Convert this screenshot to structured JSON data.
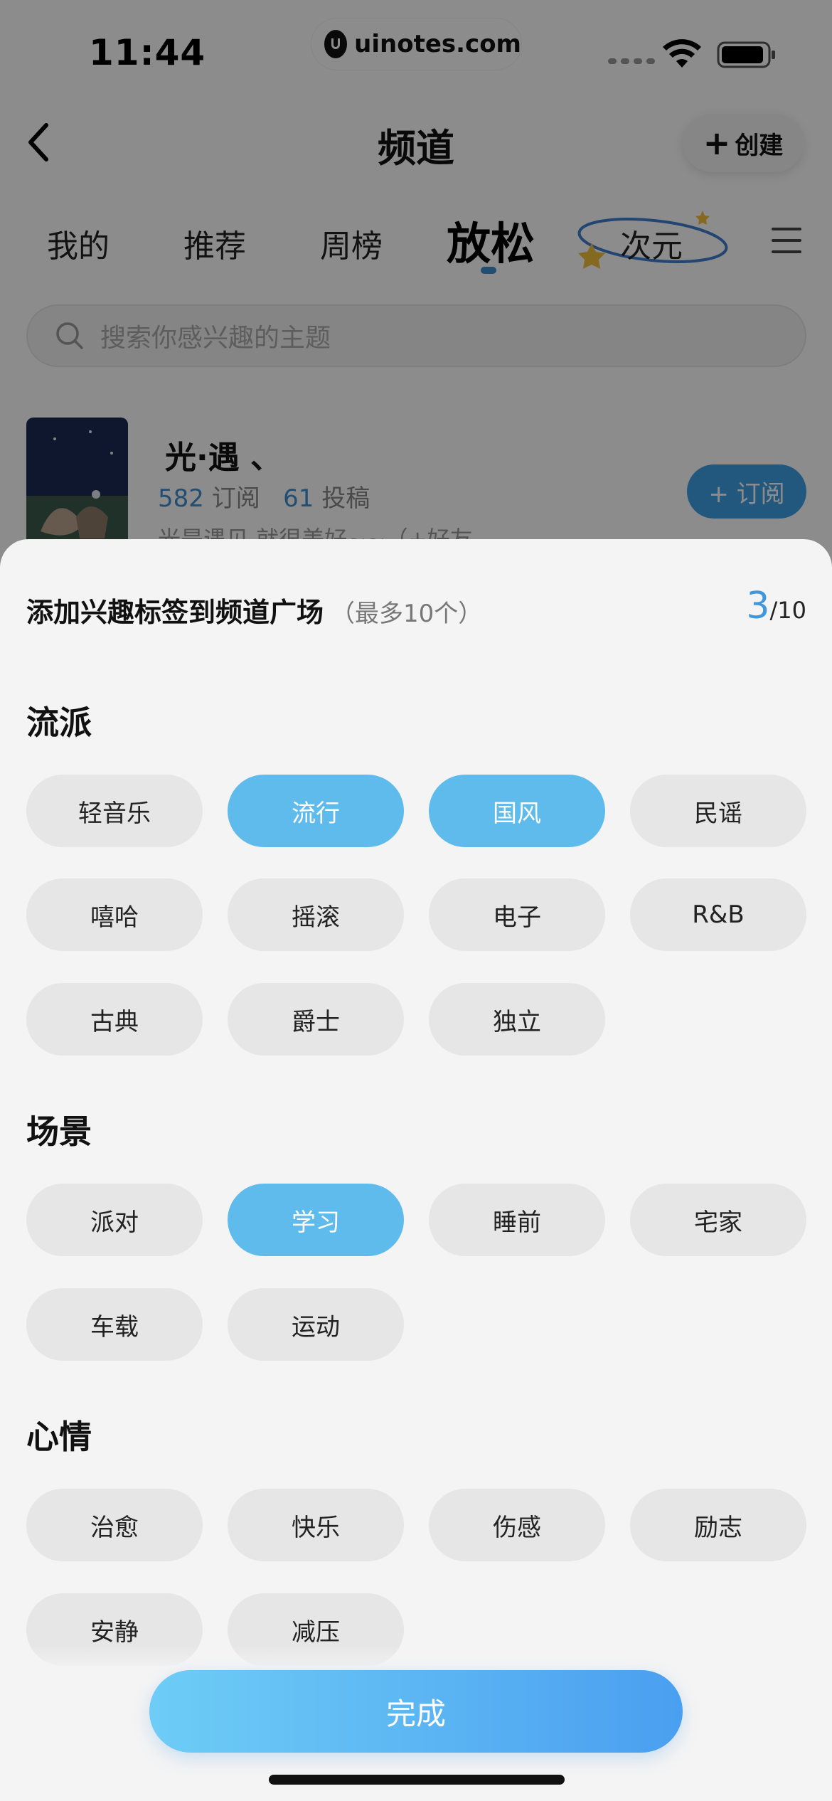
{
  "status_bar": {
    "time": "11:44",
    "watermark": "uinotes.com"
  },
  "nav": {
    "title": "频道",
    "create_label": "创建"
  },
  "tabs": [
    {
      "label": "我的",
      "active": false
    },
    {
      "label": "推荐",
      "active": false
    },
    {
      "label": "周榜",
      "active": false
    },
    {
      "label": "放松",
      "active": true
    },
    {
      "label": "次元",
      "active": false
    }
  ],
  "search": {
    "placeholder": "搜索你感兴趣的主题"
  },
  "channel": {
    "name": "光·遇 、",
    "subscribers": "582",
    "subscribers_label": "订阅",
    "posts": "61",
    "posts_label": "投稿",
    "description": "光是遇见 就很美好~~（+好友",
    "subscribe_label": "+ 订阅"
  },
  "sheet": {
    "title": "添加兴趣标签到频道广场",
    "hint": "（最多10个）",
    "selected_count": "3",
    "max_count": "/10",
    "sections": [
      {
        "title": "流派",
        "tags": [
          {
            "label": "轻音乐",
            "selected": false
          },
          {
            "label": "流行",
            "selected": true
          },
          {
            "label": "国风",
            "selected": true
          },
          {
            "label": "民谣",
            "selected": false
          },
          {
            "label": "嘻哈",
            "selected": false
          },
          {
            "label": "摇滚",
            "selected": false
          },
          {
            "label": "电子",
            "selected": false
          },
          {
            "label": "R&B",
            "selected": false
          },
          {
            "label": "古典",
            "selected": false
          },
          {
            "label": "爵士",
            "selected": false
          },
          {
            "label": "独立",
            "selected": false
          }
        ]
      },
      {
        "title": "场景",
        "tags": [
          {
            "label": "派对",
            "selected": false
          },
          {
            "label": "学习",
            "selected": true
          },
          {
            "label": "睡前",
            "selected": false
          },
          {
            "label": "宅家",
            "selected": false
          },
          {
            "label": "车载",
            "selected": false
          },
          {
            "label": "运动",
            "selected": false
          }
        ]
      },
      {
        "title": "心情",
        "tags": [
          {
            "label": "治愈",
            "selected": false
          },
          {
            "label": "快乐",
            "selected": false
          },
          {
            "label": "伤感",
            "selected": false
          },
          {
            "label": "励志",
            "selected": false
          },
          {
            "label": "安静",
            "selected": false
          },
          {
            "label": "减压",
            "selected": false
          }
        ]
      }
    ],
    "done_label": "完成"
  },
  "colors": {
    "accent": "#60bbed",
    "chip_bg": "#e6e6e6",
    "sheet_bg": "#f4f4f4",
    "link_blue": "#3f8fd0"
  }
}
